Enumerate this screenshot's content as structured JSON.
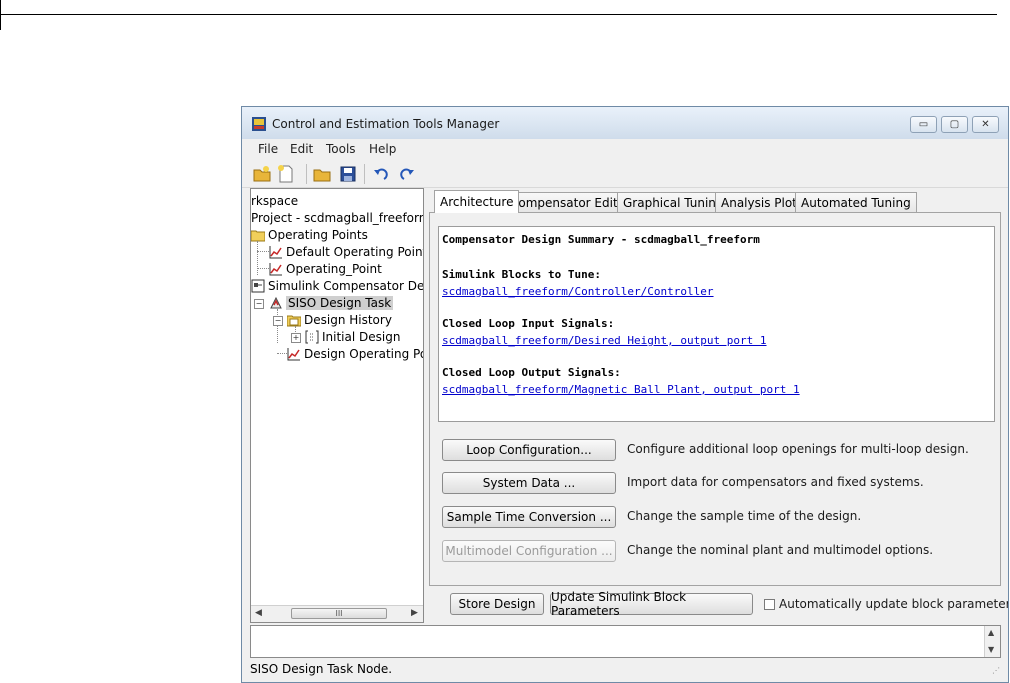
{
  "window": {
    "title": "Control and Estimation Tools Manager",
    "controls": {
      "minimize": "▭",
      "maximize": "▢",
      "close": "✕"
    }
  },
  "menu": [
    "File",
    "Edit",
    "Tools",
    "Help"
  ],
  "tree": {
    "workspace": "rkspace",
    "project": "Project - scdmagball_freeform",
    "operating_points": "Operating Points",
    "default_op": "Default Operating Point",
    "operating_point": "Operating_Point",
    "simulink_comp": "Simulink Compensator Design",
    "siso_task": "SISO Design Task",
    "design_history": "Design History",
    "initial_design": "Initial Design",
    "design_op": "Design Operating Point",
    "scroll_thumb": "III"
  },
  "tabs": [
    "Architecture",
    "Compensator Editor",
    "Graphical Tuning",
    "Analysis Plots",
    "Automated Tuning"
  ],
  "summary": {
    "title": "Compensator Design Summary - scdmagball_freeform",
    "blocks_heading": "Simulink Blocks to Tune:",
    "blocks_link": "scdmagball_freeform/Controller/Controller",
    "input_heading": "Closed Loop Input Signals:",
    "input_link": "scdmagball_freeform/Desired Height, output port 1",
    "output_heading": "Closed Loop Output Signals:",
    "output_link": "scdmagball_freeform/Magnetic Ball Plant, output port 1"
  },
  "actions": [
    {
      "label": "Loop Configuration...",
      "desc": "Configure additional loop openings for multi-loop design."
    },
    {
      "label": "System Data ...",
      "desc": "Import data for compensators and fixed systems."
    },
    {
      "label": "Sample Time Conversion ...",
      "desc": "Change the sample time of the design."
    },
    {
      "label": "Multimodel Configuration ...",
      "desc": "Change the nominal plant and multimodel options."
    }
  ],
  "bottom": {
    "store_design": "Store Design",
    "update_params": "Update Simulink Block Parameters",
    "auto_update": "Automatically update block parameters"
  },
  "status": "SISO Design Task Node."
}
